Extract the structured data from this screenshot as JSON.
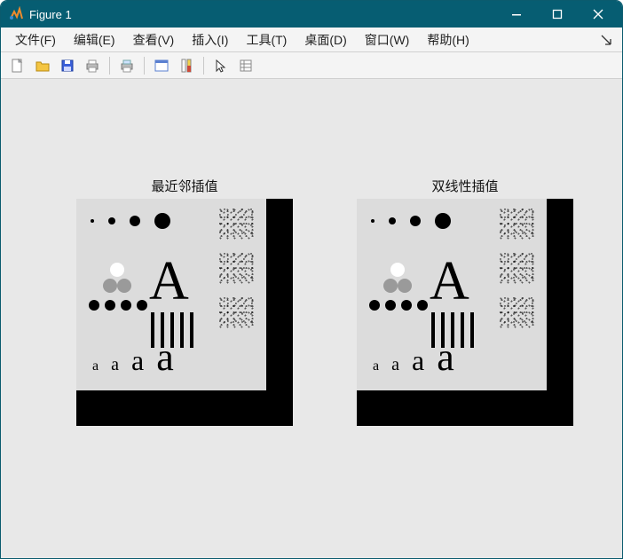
{
  "window": {
    "title": "Figure 1"
  },
  "menu": {
    "file": "文件(F)",
    "edit": "编辑(E)",
    "view": "查看(V)",
    "insert": "插入(I)",
    "tools": "工具(T)",
    "desktop": "桌面(D)",
    "window": "窗口(W)",
    "help": "帮助(H)"
  },
  "toolbar_icons": {
    "new": "new-file-icon",
    "open": "open-folder-icon",
    "save": "save-icon",
    "print": "print-icon",
    "pagesetup": "page-setup-icon",
    "datacursor": "app-window-icon",
    "colorbar": "colorbar-icon",
    "pointer": "pointer-icon",
    "property": "property-inspector-icon"
  },
  "subplots": {
    "left_title": "最近邻插值",
    "right_title": "双线性插值",
    "glyph_row": [
      "a",
      "a",
      "a",
      "a"
    ]
  }
}
